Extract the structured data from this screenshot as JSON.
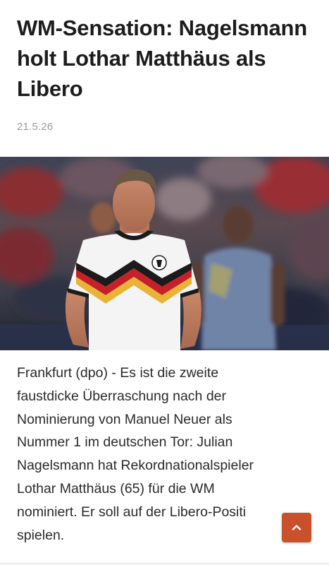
{
  "article": {
    "headline": "WM-Sensation: Nagelsmann holt Lothar Matthäus als Libero",
    "date": "21.5.26",
    "image": {
      "subject": "player-in-germany-jersey"
    },
    "body_lines": [
      "Frankfurt (dpo) - Es ist die zweite",
      "faustdicke Überraschung nach der",
      "Nominierung von Manuel Neuer als",
      "Nummer 1 im deutschen Tor: Julian",
      "Nagelsmann hat Rekordnationalspieler",
      "Lothar Matthäus (65) für die WM",
      "nominiert. Er soll auf der Libero-Positi",
      "spielen."
    ]
  },
  "controls": {
    "scroll_top_icon": "chevron-up-icon"
  },
  "colors": {
    "headline": "#1c1c1c",
    "date": "#9a9a9a",
    "body": "#2a2a2a",
    "scroll_top_bg": "#c8512b"
  }
}
